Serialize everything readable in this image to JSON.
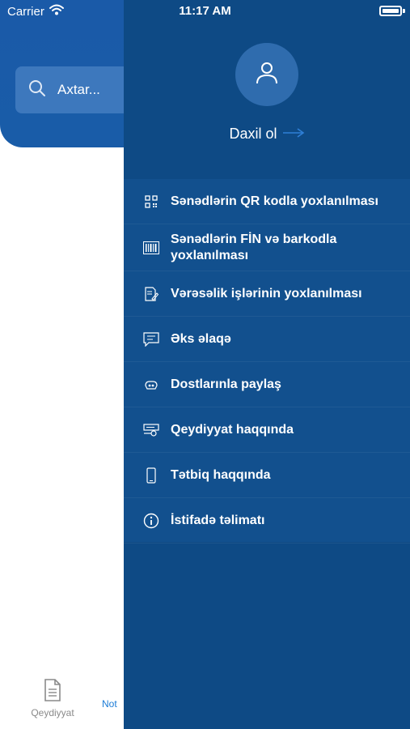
{
  "status_bar": {
    "carrier": "Carrier",
    "time": "11:17 AM"
  },
  "search": {
    "placeholder": "Axtar..."
  },
  "tabbar": {
    "tab1_label": "Qeydiyyat",
    "tab2_label": "Not"
  },
  "drawer": {
    "login_label": "Daxil ol",
    "menu": [
      {
        "icon": "qr-code-icon",
        "label": "Sənədlərin QR kodla yoxlanılması"
      },
      {
        "icon": "barcode-icon",
        "label": "Sənədlərin FİN və barkodla yoxlanılması"
      },
      {
        "icon": "document-edit-icon",
        "label": "Vərəsəlik işlərinin yoxlanılması"
      },
      {
        "icon": "feedback-icon",
        "label": "Əks əlaqə"
      },
      {
        "icon": "share-icon",
        "label": "Dostlarınla paylaş"
      },
      {
        "icon": "registration-icon",
        "label": "Qeydiyyat haqqında"
      },
      {
        "icon": "phone-icon",
        "label": "Tətbiq haqqında"
      },
      {
        "icon": "info-icon",
        "label": "İstifadə təlimatı"
      }
    ]
  },
  "colors": {
    "header_blue": "#1a5aa8",
    "drawer_blue": "#0e4a85",
    "accent": "#1a7bd6"
  }
}
